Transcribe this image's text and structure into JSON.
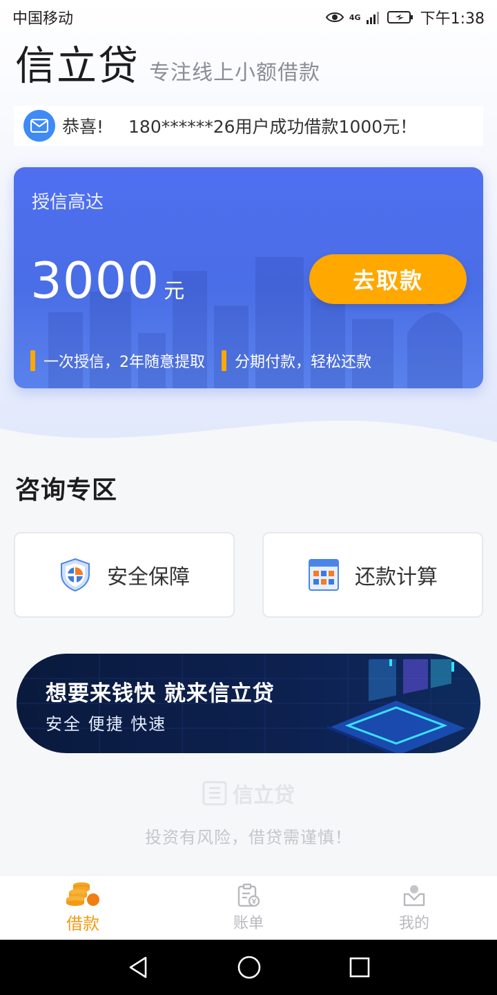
{
  "status_bar": {
    "carrier": "中国移动",
    "network": "4G",
    "time": "下午1:38"
  },
  "header": {
    "app_name": "信立贷",
    "slogan": "专注线上小额借款"
  },
  "notice": {
    "title": "恭喜!",
    "message": "180******26用户成功借款1000元！"
  },
  "credit_card": {
    "label": "授信高达",
    "amount": "3000",
    "unit": "元",
    "button": "去取款",
    "features": [
      "一次授信，2年随意提取",
      "分期付款，轻松还款"
    ]
  },
  "consult": {
    "title": "咨询专区",
    "tiles": [
      {
        "label": "安全保障",
        "icon": "shield-icon"
      },
      {
        "label": "还款计算",
        "icon": "calculator-icon"
      }
    ]
  },
  "banner": {
    "title": "想要来钱快 就来信立贷",
    "subtitle": "安全 便捷 快速"
  },
  "footer": {
    "brand": "信立贷",
    "note": "投资有风险，借贷需谨慎！"
  },
  "tabbar": {
    "items": [
      {
        "label": "借款",
        "icon": "coins-icon",
        "active": true
      },
      {
        "label": "账单",
        "icon": "bill-icon",
        "active": false
      },
      {
        "label": "我的",
        "icon": "profile-icon",
        "active": false
      }
    ]
  },
  "colors": {
    "primary": "#4f6ff0",
    "accent": "#ffa800",
    "active_tab": "#f29b12"
  }
}
